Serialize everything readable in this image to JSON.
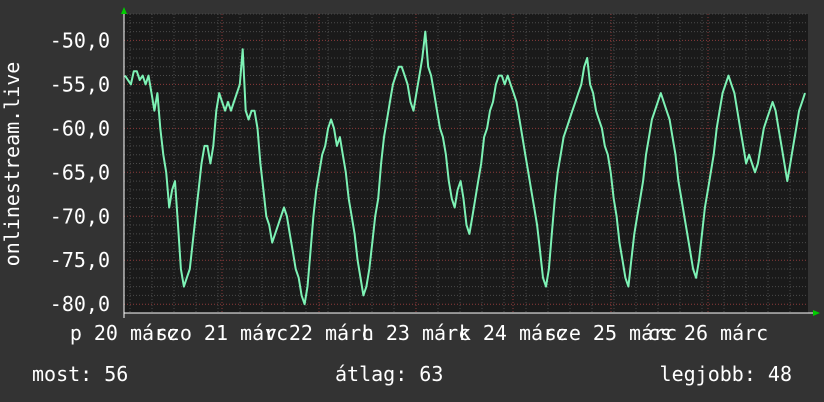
{
  "chart_data": {
    "type": "line",
    "title": "",
    "xlabel": "",
    "ylabel": "onlinestream.live",
    "ylim": [
      -81,
      -47
    ],
    "y_ticks": [
      -50,
      -55,
      -60,
      -65,
      -70,
      -75,
      -80
    ],
    "y_tick_labels": [
      "-50,0",
      "-55,0",
      "-60,0",
      "-65,0",
      "-70,0",
      "-75,0",
      "-80,0"
    ],
    "x_tick_labels": [
      "p 20 márc",
      "szo 21 márc",
      "v 22 márc",
      "h 23 márc",
      "k 24 márc",
      "sze 25 márc",
      "cs 26 márc"
    ],
    "grid": true,
    "series": [
      {
        "color": "#7df2b5",
        "values": [
          -54,
          -54.5,
          -55,
          -53.5,
          -53.5,
          -54.5,
          -54,
          -55,
          -54,
          -56,
          -58,
          -56,
          -60,
          -63,
          -65,
          -69,
          -67,
          -66,
          -71,
          -76,
          -78,
          -77,
          -76,
          -73,
          -70,
          -67,
          -64,
          -62,
          -62,
          -64,
          -62,
          -58,
          -56,
          -57,
          -58,
          -57,
          -58,
          -57,
          -56,
          -55,
          -51,
          -58,
          -59,
          -58,
          -58,
          -60,
          -64,
          -67,
          -70,
          -71,
          -73,
          -72,
          -71,
          -70,
          -69,
          -70,
          -72,
          -74,
          -76,
          -77,
          -79,
          -80,
          -78,
          -74,
          -70,
          -67,
          -65,
          -63,
          -62,
          -60,
          -59,
          -60,
          -62,
          -61,
          -63,
          -65,
          -68,
          -70,
          -72,
          -75,
          -77,
          -79,
          -78,
          -76,
          -73,
          -70,
          -68,
          -64,
          -61,
          -59,
          -57,
          -55,
          -54,
          -53,
          -53,
          -54,
          -55,
          -57,
          -58,
          -56,
          -54,
          -52,
          -49,
          -53,
          -54,
          -56,
          -58,
          -60,
          -61,
          -63,
          -66,
          -68,
          -69,
          -67,
          -66,
          -68,
          -71,
          -72,
          -70,
          -68,
          -66,
          -64,
          -61,
          -60,
          -58,
          -57,
          -55,
          -54,
          -54,
          -55,
          -54,
          -55,
          -56,
          -57,
          -59,
          -61,
          -63,
          -65,
          -67,
          -69,
          -71,
          -74,
          -77,
          -78,
          -76,
          -72,
          -68,
          -65,
          -63,
          -61,
          -60,
          -59,
          -58,
          -57,
          -56,
          -55,
          -53,
          -52,
          -55,
          -56,
          -58,
          -59,
          -60,
          -62,
          -63,
          -65,
          -68,
          -70,
          -73,
          -75,
          -77,
          -78,
          -75,
          -72,
          -70,
          -68,
          -66,
          -63,
          -61,
          -59,
          -58,
          -57,
          -56,
          -57,
          -58,
          -59,
          -61,
          -63,
          -66,
          -68,
          -70,
          -72,
          -74,
          -76,
          -77,
          -75,
          -72,
          -69,
          -67,
          -65,
          -63,
          -60,
          -58,
          -56,
          -55,
          -54,
          -55,
          -56,
          -58,
          -60,
          -62,
          -64,
          -63,
          -64,
          -65,
          -64,
          -62,
          -60,
          -59,
          -58,
          -57,
          -58,
          -60,
          -62,
          -64,
          -66,
          -64,
          -62,
          -60,
          -58,
          -57,
          -56
        ]
      }
    ]
  },
  "footer": {
    "now_label": "most:",
    "now_value": "56",
    "avg_label": "átlag:",
    "avg_value": "63",
    "best_label": "legjobb:",
    "best_value": "48"
  },
  "colors": {
    "background": "#333333",
    "plot_background": "#1a1a1a",
    "grid_major": "#8c3a3a",
    "grid_minor": "#4a4a4a",
    "axis": "#ffffff",
    "arrow": "#00cc00",
    "line": "#7df2b5",
    "text": "#ffffff"
  }
}
